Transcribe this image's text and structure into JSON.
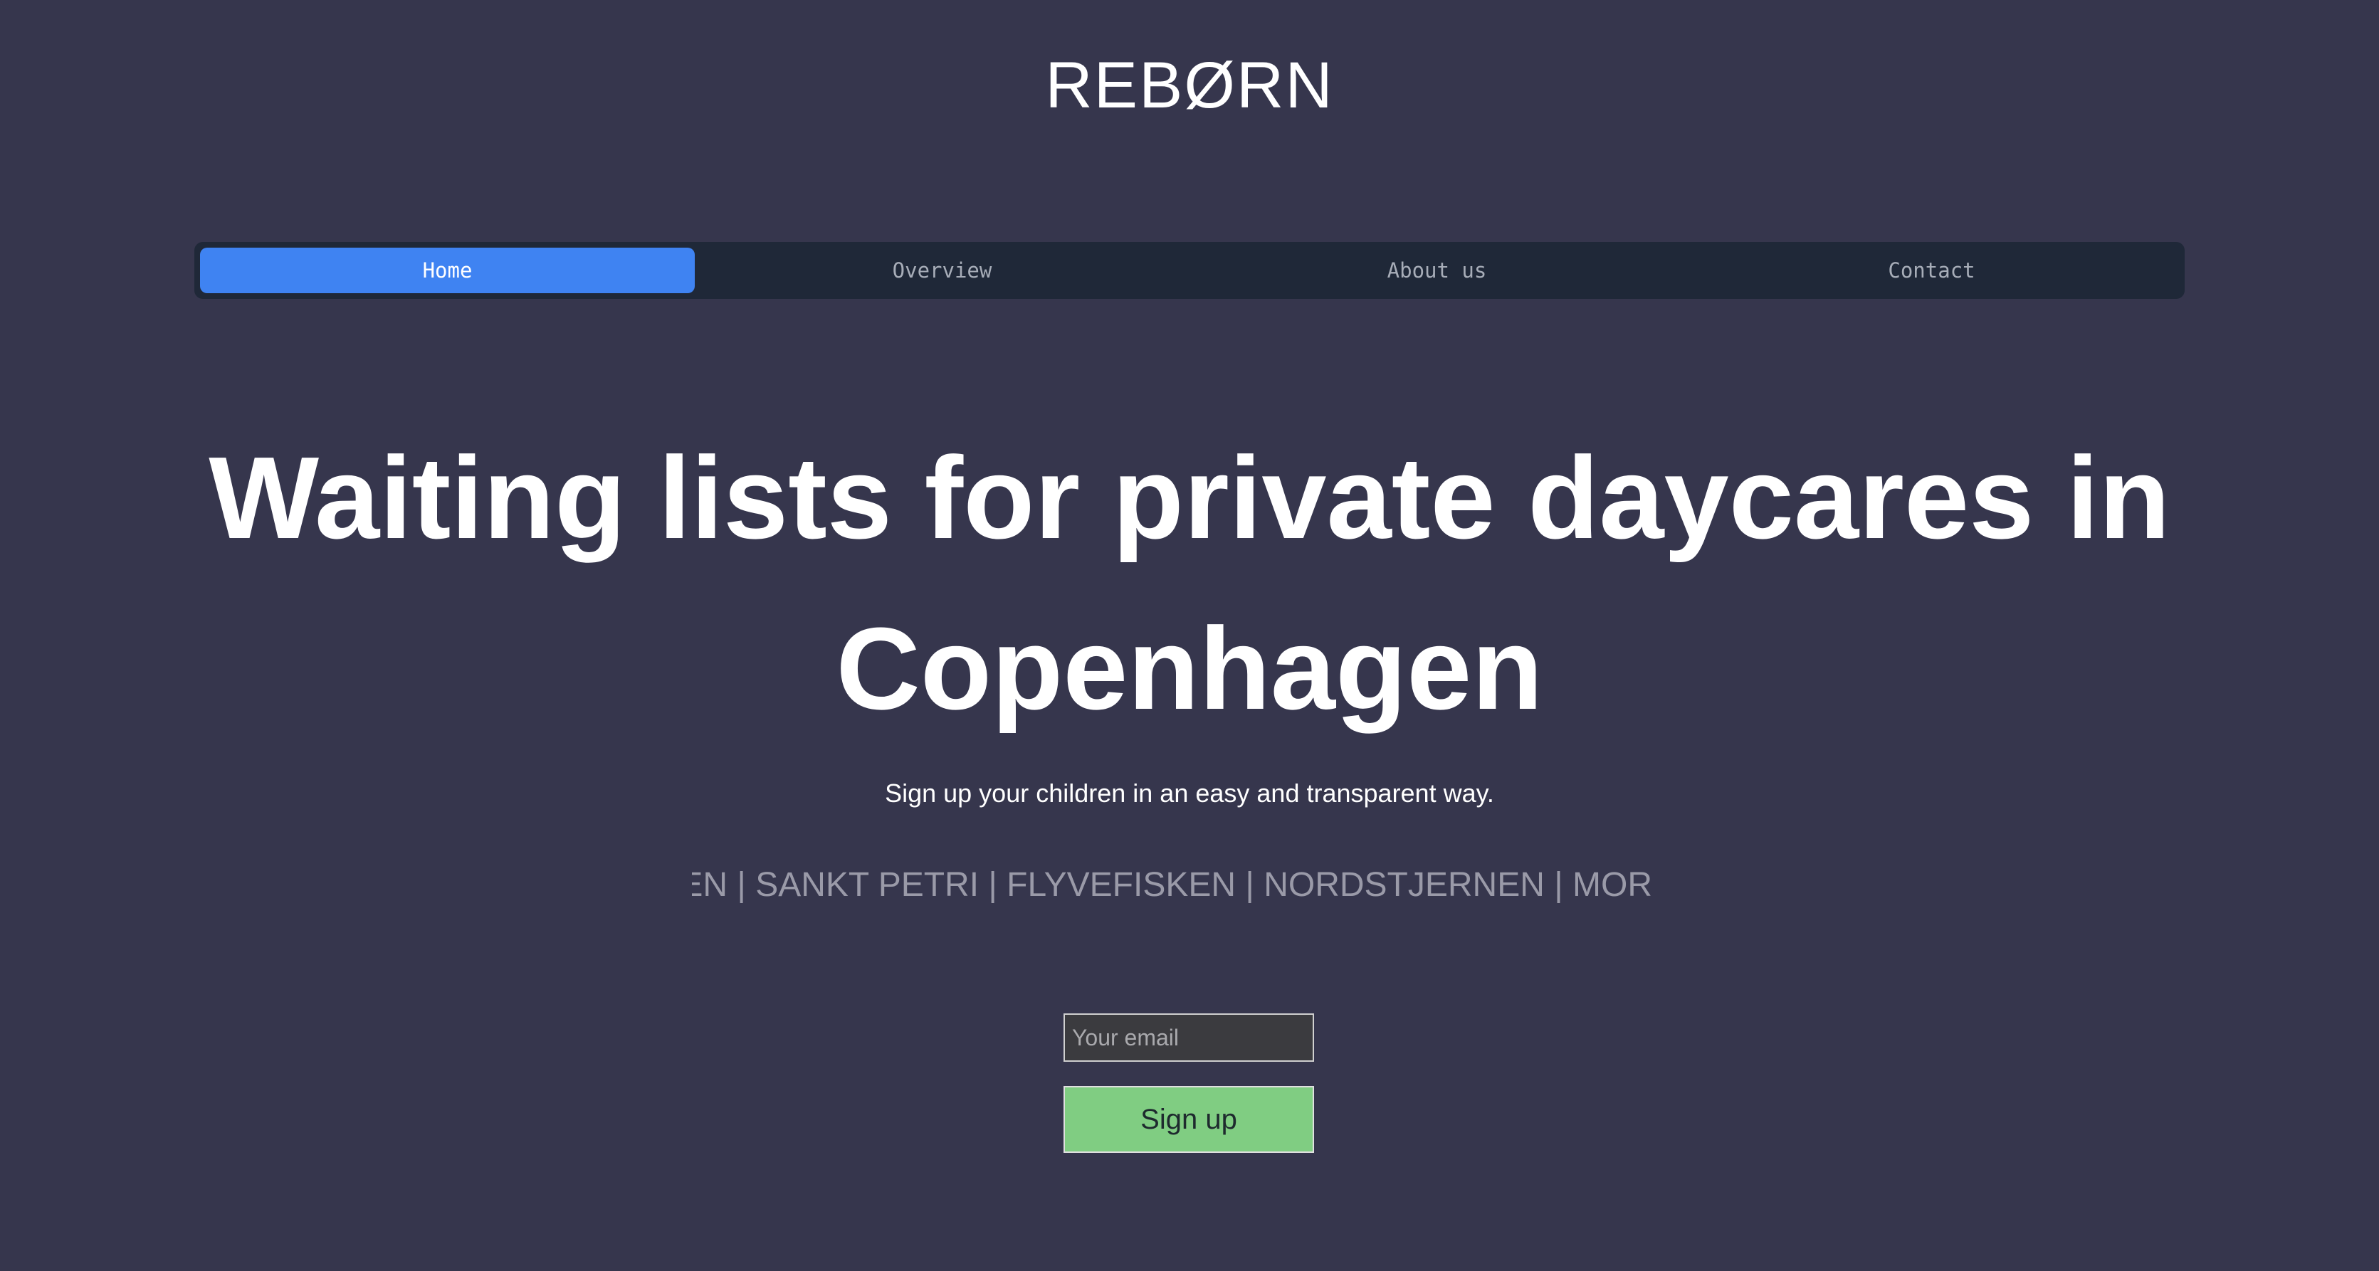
{
  "header": {
    "logo": "REBØRN"
  },
  "nav": {
    "tabs": [
      {
        "label": "Home",
        "active": true
      },
      {
        "label": "Overview",
        "active": false
      },
      {
        "label": "About us",
        "active": false
      },
      {
        "label": "Contact",
        "active": false
      }
    ]
  },
  "hero": {
    "headline": "Waiting lists for private daycares in Copenhagen",
    "subtitle": "Sign up your children in an easy and transparent way.",
    "ticker": "ØPPEN | SANKT PETRI | FLYVEFISKEN | NORDSTJERNEN | MOR"
  },
  "form": {
    "email_placeholder": "Your email",
    "email_value": "",
    "signup_label": "Sign up"
  },
  "colors": {
    "background": "#36364d",
    "nav_background": "#1f2838",
    "active_tab": "#3f83f2",
    "signup_button": "#80cd82",
    "ticker_text": "#9a9aa8"
  }
}
